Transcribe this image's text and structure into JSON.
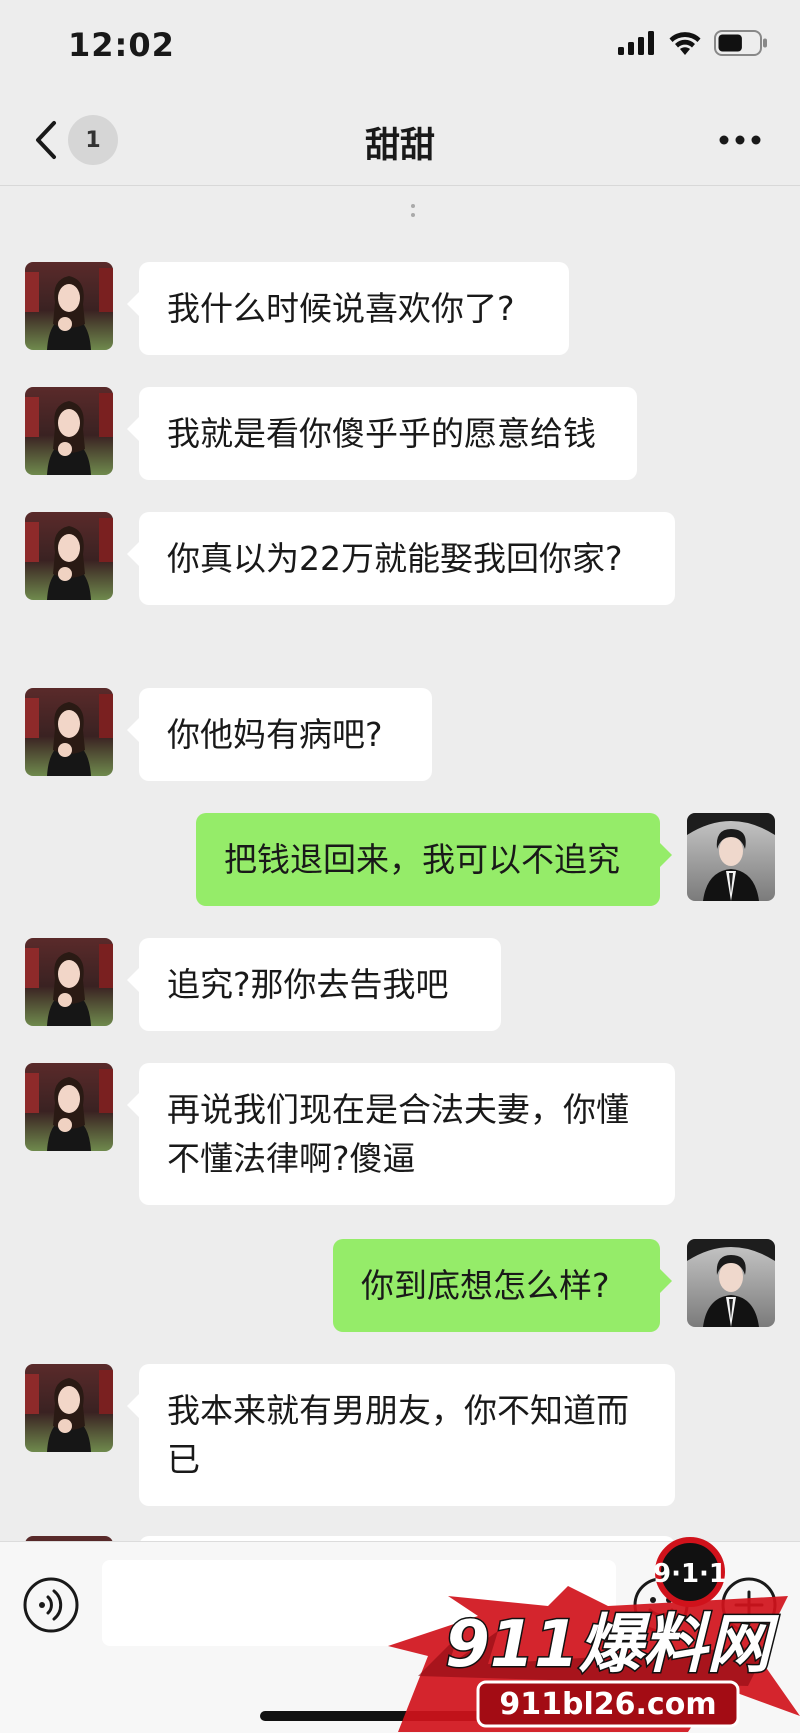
{
  "status_bar": {
    "time": "12:02",
    "battery_level": 0.6
  },
  "nav": {
    "unread_count": "1",
    "title": "甜甜"
  },
  "messages": [
    {
      "side": "left",
      "text": "我什么时候说喜欢你了?"
    },
    {
      "side": "left",
      "text": "我就是看你傻乎乎的愿意给钱"
    },
    {
      "side": "left",
      "text": "你真以为22万就能娶我回你家?"
    },
    {
      "side": "left",
      "text": "你他妈有病吧?"
    },
    {
      "side": "right",
      "text": "把钱退回来，我可以不追究"
    },
    {
      "side": "left",
      "text": "追究?那你去告我吧"
    },
    {
      "side": "left",
      "text": "再说我们现在是合法夫妻，你懂不懂法律啊?傻逼"
    },
    {
      "side": "right",
      "text": "你到底想怎么样?"
    },
    {
      "side": "left",
      "text": "我本来就有男朋友，你不知道而已"
    }
  ],
  "input": {
    "value": "",
    "placeholder": ""
  },
  "watermark": {
    "badge": "9·1·1",
    "brand": "911爆料网",
    "url": "911bl26.com"
  },
  "colors": {
    "background": "#ededed",
    "outgoing_bubble": "#95ec69",
    "incoming_bubble": "#ffffff",
    "watermark_red": "#d0121b"
  }
}
